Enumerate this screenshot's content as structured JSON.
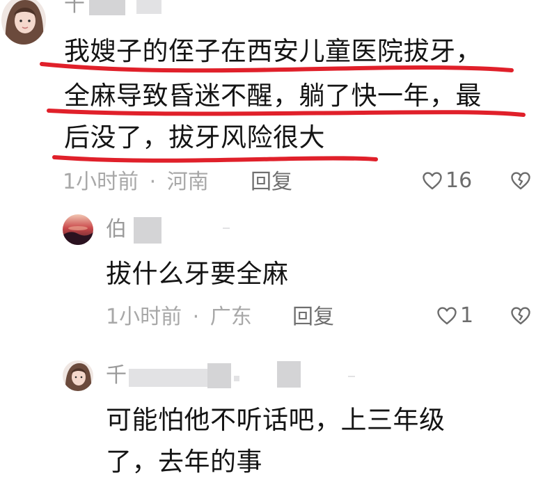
{
  "comments": [
    {
      "username": "千",
      "text_lines": [
        "我嫂子的侄子在西安儿童医院拔牙，",
        "全麻导致昏迷不醒，躺了快一年，最",
        "后没了，拔牙风险很大"
      ],
      "time": "1小时前",
      "separator": "·",
      "location": "河南",
      "reply_label": "回复",
      "likes": "16"
    },
    {
      "username": "伯",
      "text_lines": [
        "拔什么牙要全麻"
      ],
      "time": "1小时前",
      "separator": "·",
      "location": "广东",
      "reply_label": "回复",
      "likes": "1"
    },
    {
      "username": "千",
      "text_lines": [
        "可能怕他不听话吧，上三年级",
        "了，去年的事"
      ]
    }
  ],
  "colors": {
    "annotation_red": "#e0202a",
    "meta_gray": "#a8a8a8",
    "redaction_gray": "#d4d4d6"
  },
  "icons": {
    "like": "heart-outline-icon",
    "dislike": "broken-heart-icon"
  }
}
